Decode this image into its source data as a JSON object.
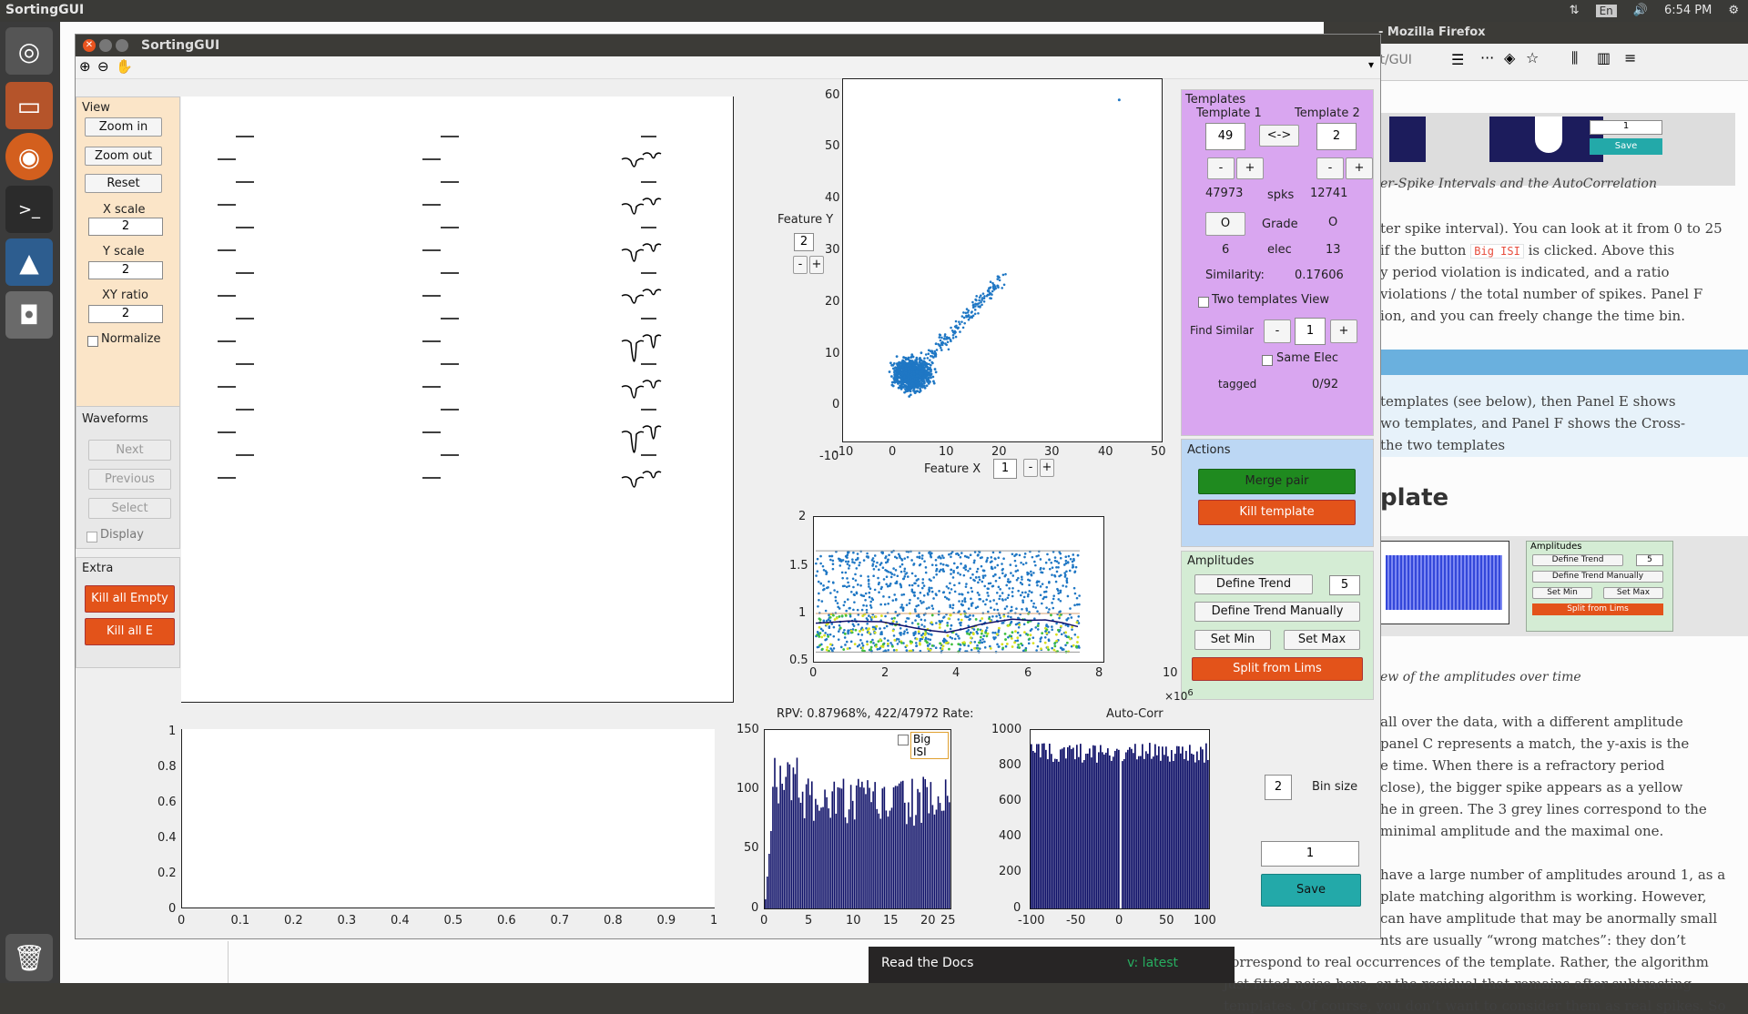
{
  "topbar": {
    "app_title": "SortingGUI",
    "lang": "En",
    "time": "6:54 PM"
  },
  "firefox": {
    "window_title": "- Mozilla Firefox",
    "url_fragment": "n/latest/GUI",
    "caption1": "er-Spike Intervals and the AutoCorrelation",
    "para1": [
      "ter spike interval). You can look at it from 0 to 25",
      "if the button",
      "is clicked. Above this",
      "y period violation is indicated, and a ratio",
      "violations / the total number of spikes. Panel F",
      "ion, and you can freely change the time bin."
    ],
    "big_isi_code": "Big ISI",
    "para2": [
      "templates (see below), then Panel E shows",
      "wo templates, and Panel F shows the Cross-",
      "the two templates"
    ],
    "heading": "plate",
    "mini_amplitudes": {
      "title": "Amplitudes",
      "define_trend": "Define Trend",
      "define_manual": "Define Trend Manually",
      "set_min": "Set Min",
      "set_max": "Set Max",
      "split": "Split from Lims",
      "value": "5"
    },
    "mini_save": {
      "value": "1",
      "save": "Save"
    },
    "caption2": "ew of the amplitudes over time",
    "para3": [
      "all over the data, with a different amplitude",
      "panel C represents a match, the y-axis is the",
      "e time. When there is a refractory period",
      "close), the bigger spike appears as a yellow",
      "he in green. The 3 grey lines correspond to the",
      "minimal amplitude and the maximal one."
    ],
    "para4": [
      "have a large number of amplitudes around 1, as a",
      "plate matching algorithm is working. However,",
      "can have amplitude that may be anormally small",
      "nts are usually “wrong matches”: they don’t",
      "correspond to real occurrences of the template. Rather, the algorithm",
      "just fitted noise here, or the residual that remains after subtracting",
      "templates. Of course, you don’t want to consider them as real spikes. So"
    ],
    "rtd": {
      "label": "Read the Docs",
      "version": "v: latest"
    }
  },
  "window": {
    "title": "SortingGUI"
  },
  "view_panel": {
    "title": "View",
    "zoom_in": "Zoom in",
    "zoom_out": "Zoom out",
    "reset": "Reset",
    "x_scale_label": "X scale",
    "x_scale": "2",
    "y_scale_label": "Y scale",
    "y_scale": "2",
    "xy_ratio_label": "XY ratio",
    "xy_ratio": "2",
    "normalize": "Normalize"
  },
  "waveforms_panel": {
    "title": "Waveforms",
    "next": "Next",
    "previous": "Previous",
    "select": "Select",
    "display": "Display"
  },
  "extra_panel": {
    "title": "Extra",
    "kill_empty": "Kill all Empty",
    "kill_e": "Kill all E"
  },
  "feature": {
    "y_label": "Feature Y",
    "y_value": "2",
    "x_label": "Feature X",
    "x_value": "1",
    "minus": "-",
    "plus": "+",
    "yticks": [
      "60",
      "50",
      "40",
      "30",
      "20",
      "10",
      "0",
      "-10"
    ],
    "xticks": [
      "-10",
      "0",
      "10",
      "20",
      "30",
      "40",
      "50"
    ]
  },
  "templates_panel": {
    "title": "Templates",
    "t1_label": "Template 1",
    "t2_label": "Template 2",
    "t1": "49",
    "t2": "2",
    "swap": "<->",
    "minus": "-",
    "plus": "+",
    "spks1": "47973",
    "spks_label": "spks",
    "spks2": "12741",
    "grade1": "O",
    "grade_label": "Grade",
    "grade2": "O",
    "elec1": "6",
    "elec_label": "elec",
    "elec2": "13",
    "similarity_label": "Similarity:",
    "similarity": "0.17606",
    "two_view": "Two templates View",
    "find_similar": "Find Similar",
    "find_value": "1",
    "same_elec": "Same Elec",
    "tagged_label": "tagged",
    "tagged": "0/92"
  },
  "actions_panel": {
    "title": "Actions",
    "merge": "Merge pair",
    "kill": "Kill template"
  },
  "amplitudes_panel": {
    "title": "Amplitudes",
    "define_trend": "Define Trend",
    "trend_value": "5",
    "define_manual": "Define Trend Manually",
    "set_min": "Set Min",
    "set_max": "Set Max",
    "split": "Split from Lims"
  },
  "amp_plot": {
    "yticks": [
      "2",
      "1.5",
      "1",
      "0.5"
    ],
    "xticks": [
      "0",
      "2",
      "4",
      "6",
      "8",
      "10"
    ],
    "exp": "×10",
    "exp_power": "6"
  },
  "empty_plot": {
    "yticks": [
      "1",
      "0.8",
      "0.6",
      "0.4",
      "0.2",
      "0"
    ],
    "xticks": [
      "0",
      "0.1",
      "0.2",
      "0.3",
      "0.4",
      "0.5",
      "0.6",
      "0.7",
      "0.8",
      "0.9",
      "1"
    ]
  },
  "isi": {
    "rpv": "RPV: 0.87968%, 422/47972 Rate:",
    "big_isi": "Big ISI",
    "yticks": [
      "150",
      "100",
      "50",
      "0"
    ],
    "xticks": [
      "0",
      "5",
      "10",
      "15",
      "20",
      "25"
    ]
  },
  "autocorr": {
    "title": "Auto-Corr",
    "yticks": [
      "1000",
      "800",
      "600",
      "400",
      "200",
      "0"
    ],
    "xticks": [
      "-100",
      "-50",
      "0",
      "50",
      "100"
    ]
  },
  "bin": {
    "value": "2",
    "label": "Bin size",
    "save_value": "1",
    "save": "Save"
  },
  "colors": {
    "orange_btn": "#e3531a",
    "green_btn": "#1f8a1f",
    "template_bg": "#d9a6f0",
    "actions_bg": "#bcd7f4",
    "amplitudes_bg": "#d4ecd4",
    "view_bg": "#fbe5c8",
    "scatter": "#1f77c4",
    "bars": "#0f1168"
  }
}
